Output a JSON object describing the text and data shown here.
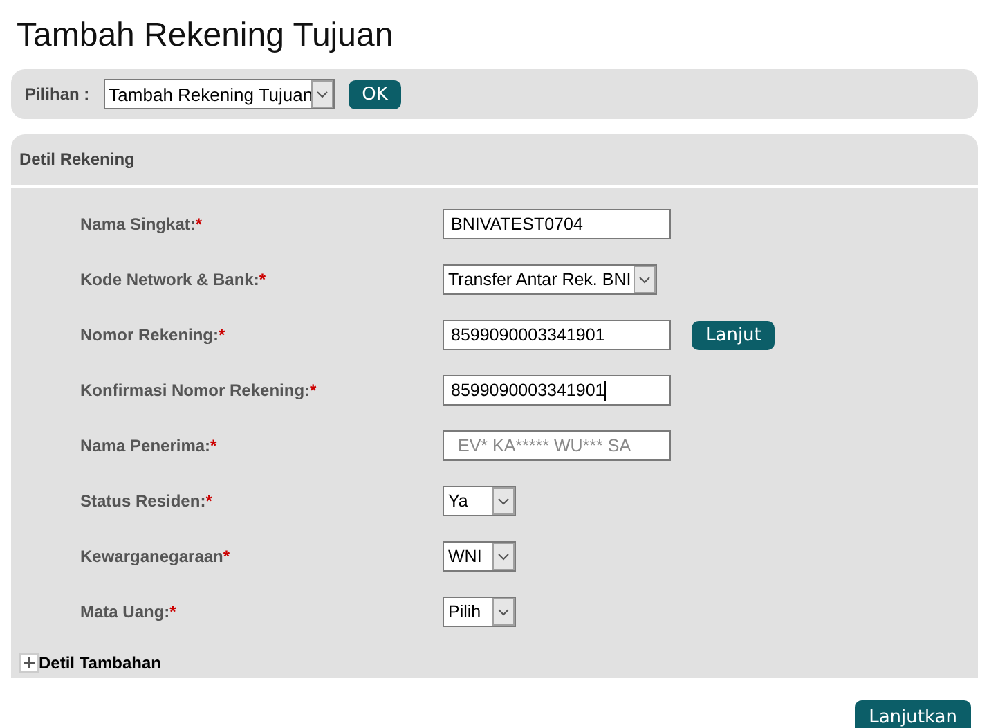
{
  "page_title": "Tambah Rekening Tujuan",
  "selector": {
    "label": "Pilihan :",
    "value": "Tambah Rekening Tujuan",
    "button": "OK"
  },
  "panel": {
    "title": "Detil Rekening",
    "fields": [
      {
        "label": "Nama Singkat:",
        "mark": "*",
        "kind": "text",
        "value": "BNIVATEST0704"
      },
      {
        "label": "Kode Network & Bank:",
        "mark": "*",
        "kind": "select",
        "value": "Transfer Antar Rek. BNI"
      },
      {
        "label": "Nomor Rekening:",
        "mark": "*",
        "kind": "text",
        "value": "8599090003341901",
        "button": "Lanjut"
      },
      {
        "label": "Konfirmasi Nomor Rekening:",
        "mark": "*",
        "kind": "text",
        "value": "8599090003341901",
        "focused": true
      },
      {
        "label": "Nama Penerima:",
        "mark": "*",
        "kind": "readonly",
        "value": "EV* KA***** WU*** SA"
      },
      {
        "label": "Status Residen:",
        "mark": "*",
        "kind": "select",
        "value": "Ya"
      },
      {
        "label": "Kewarganegaraan",
        "mark": "*",
        "kind": "select",
        "value": "WNI"
      },
      {
        "label": "Mata Uang:",
        "mark": "*",
        "kind": "select",
        "value": "Pilih"
      }
    ],
    "expander": {
      "label": "Detil Tambahan",
      "expanded": false
    }
  },
  "submit": "Lanjutkan"
}
